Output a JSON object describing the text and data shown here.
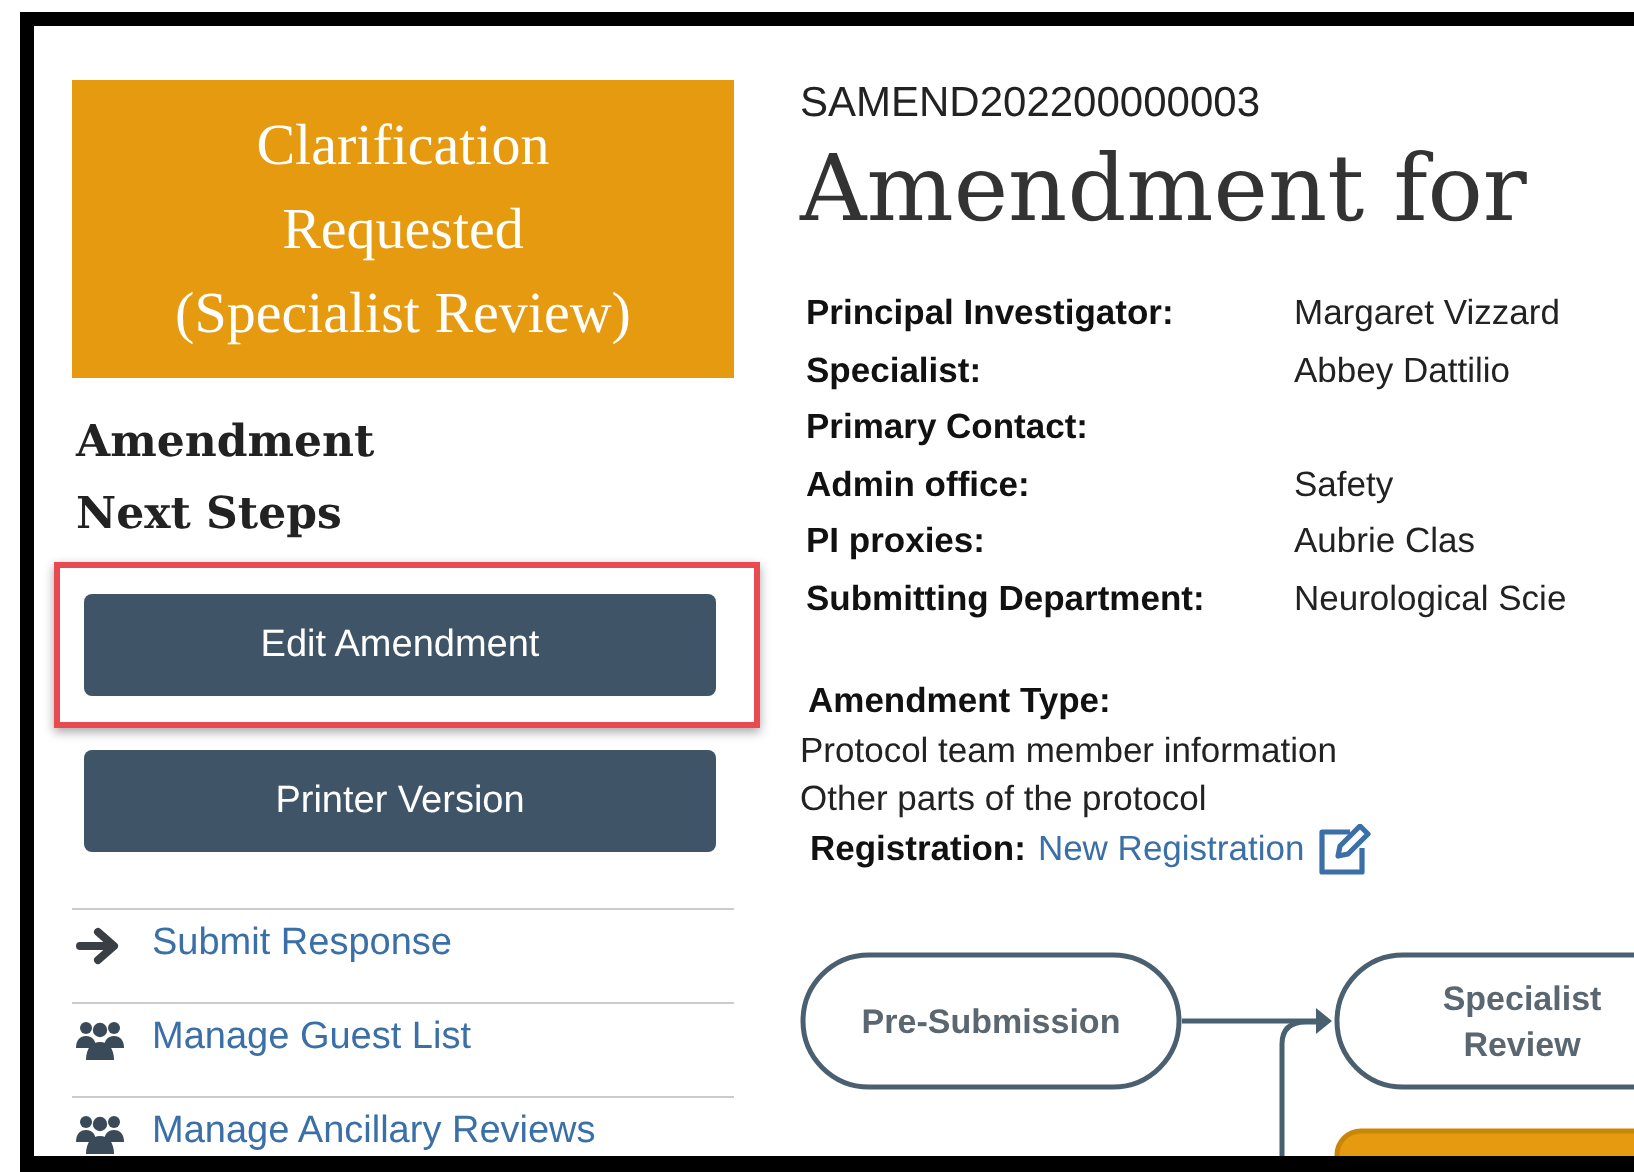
{
  "status": {
    "lines": [
      "Clarification",
      "Requested",
      "(Specialist Review)"
    ],
    "color": "#e59a10"
  },
  "next_steps": {
    "title": "Amendment Next Steps",
    "buttons": [
      {
        "label": "Edit Amendment",
        "highlighted": true
      },
      {
        "label": "Printer Version",
        "highlighted": false
      }
    ],
    "actions": [
      {
        "kind": "arrow",
        "label": "Submit Response"
      },
      {
        "kind": "people",
        "label": "Manage Guest List"
      },
      {
        "kind": "people",
        "label": "Manage Ancillary Reviews"
      }
    ]
  },
  "record": {
    "id": "SAMEND202200000003",
    "title": "Amendment for",
    "fields": [
      {
        "label": "Principal Investigator:",
        "value": "Margaret Vizzard"
      },
      {
        "label": "Specialist:",
        "value": "Abbey Dattilio"
      },
      {
        "label": "Primary Contact:"
      },
      {
        "label": "Admin office:",
        "value": "Safety"
      },
      {
        "label": "PI proxies:",
        "value": "Aubrie Clas"
      },
      {
        "label": "Submitting Department:",
        "value": "Neurological Scie"
      }
    ],
    "amendment_type": {
      "label": "Amendment Type:",
      "items": [
        "Protocol team member information",
        "Other parts of the protocol"
      ]
    },
    "registration": {
      "label": "Registration:",
      "link": "New Registration"
    }
  },
  "workflow": {
    "nodes": [
      {
        "label": "Pre-Submission",
        "current": false
      },
      {
        "label": "Specialist Review",
        "current": false
      },
      {
        "current": true
      }
    ]
  }
}
